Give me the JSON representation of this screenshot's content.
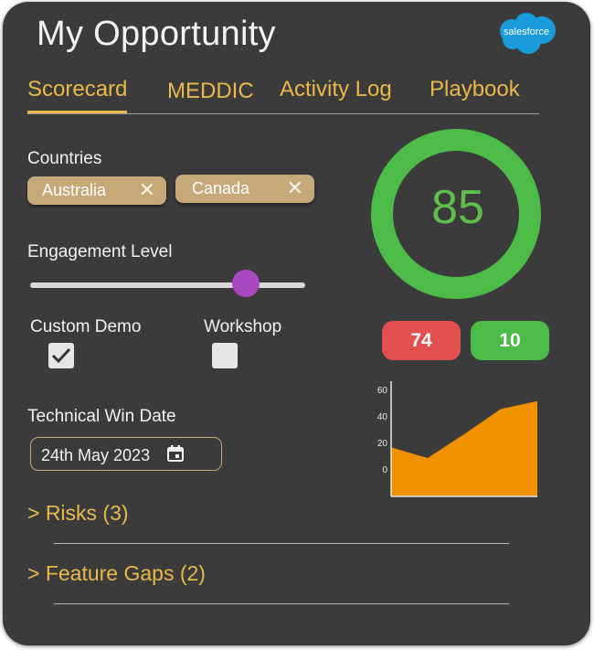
{
  "header": {
    "title": "My Opportunity",
    "logo_text": "salesforce"
  },
  "tabs": [
    {
      "label": "Scorecard",
      "active": true
    },
    {
      "label": "MEDDIC",
      "active": false
    },
    {
      "label": "Activity Log",
      "active": false
    },
    {
      "label": "Playbook",
      "active": false
    }
  ],
  "countries": {
    "label": "Countries",
    "chips": [
      "Australia",
      "Canada"
    ]
  },
  "engagement": {
    "label": "Engagement Level",
    "value_fraction": 0.78
  },
  "checkboxes": [
    {
      "label": "Custom Demo",
      "checked": true
    },
    {
      "label": "Workshop",
      "checked": false
    }
  ],
  "technical_win": {
    "label": "Technical Win Date",
    "value": "24th May 2023"
  },
  "sections": [
    {
      "label": "> Risks (3)"
    },
    {
      "label": "> Feature Gaps (2)"
    }
  ],
  "score": {
    "value": "85",
    "color": "#4cbb47"
  },
  "pills": {
    "red_value": "74",
    "green_value": "10",
    "red_color": "#e24f4f",
    "green_color": "#4cbb47"
  },
  "colors": {
    "accent": "#e9b949",
    "chip": "#c5a978",
    "slider_thumb": "#a949c1",
    "area_fill": "#f09200"
  },
  "chart_data": {
    "type": "area",
    "x": [
      0,
      1,
      2,
      3,
      4
    ],
    "values": [
      17,
      9,
      27,
      46,
      52
    ],
    "ytick_labels": [
      "60",
      "40",
      "20",
      "0"
    ],
    "ytick_values": [
      60,
      40,
      20,
      0
    ],
    "ylim": [
      -20,
      67
    ]
  }
}
